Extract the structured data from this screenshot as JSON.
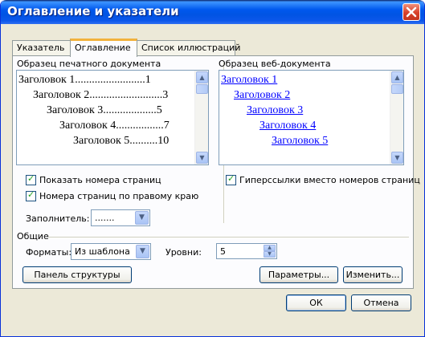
{
  "window": {
    "title": "Оглавление и указатели"
  },
  "tabs": [
    {
      "label": "Указатель"
    },
    {
      "label": "Оглавление"
    },
    {
      "label": "Список иллюстраций"
    }
  ],
  "print_preview": {
    "label": "Образец печатного документа",
    "lines": [
      {
        "text": "Заголовок 1",
        "dots": ".........................",
        "page": "1"
      },
      {
        "text": "Заголовок 2",
        "dots": "..........................",
        "page": "3"
      },
      {
        "text": "Заголовок 3",
        "dots": "...................",
        "page": "5"
      },
      {
        "text": "Заголовок 4",
        "dots": ".................",
        "page": "7"
      },
      {
        "text": "Заголовок 5",
        "dots": "..........",
        "page": "10"
      }
    ]
  },
  "web_preview": {
    "label": "Образец веб-документа",
    "links": [
      "Заголовок 1",
      "Заголовок 2",
      "Заголовок 3",
      "Заголовок 4",
      "Заголовок 5"
    ]
  },
  "options": {
    "show_page_numbers": {
      "label": "Показать номера страниц",
      "checked": true
    },
    "right_align_numbers": {
      "label": "Номера страниц по правому краю",
      "checked": true
    },
    "hyperlinks": {
      "label": "Гиперссылки вместо номеров страниц",
      "checked": true
    },
    "tab_leader": {
      "label": "Заполнитель:",
      "value": "......."
    }
  },
  "general": {
    "label": "Общие",
    "formats": {
      "label": "Форматы:",
      "value": "Из шаблона"
    },
    "levels": {
      "label": "Уровни:",
      "value": "5"
    }
  },
  "buttons": {
    "outline_toolbar": "Панель структуры",
    "options": "Параметры...",
    "modify": "Изменить...",
    "ok": "ОК",
    "cancel": "Отмена"
  },
  "colors": {
    "title_bar": "#0054e3",
    "link": "#0000ff",
    "dialog_bg": "#ece9d8"
  }
}
